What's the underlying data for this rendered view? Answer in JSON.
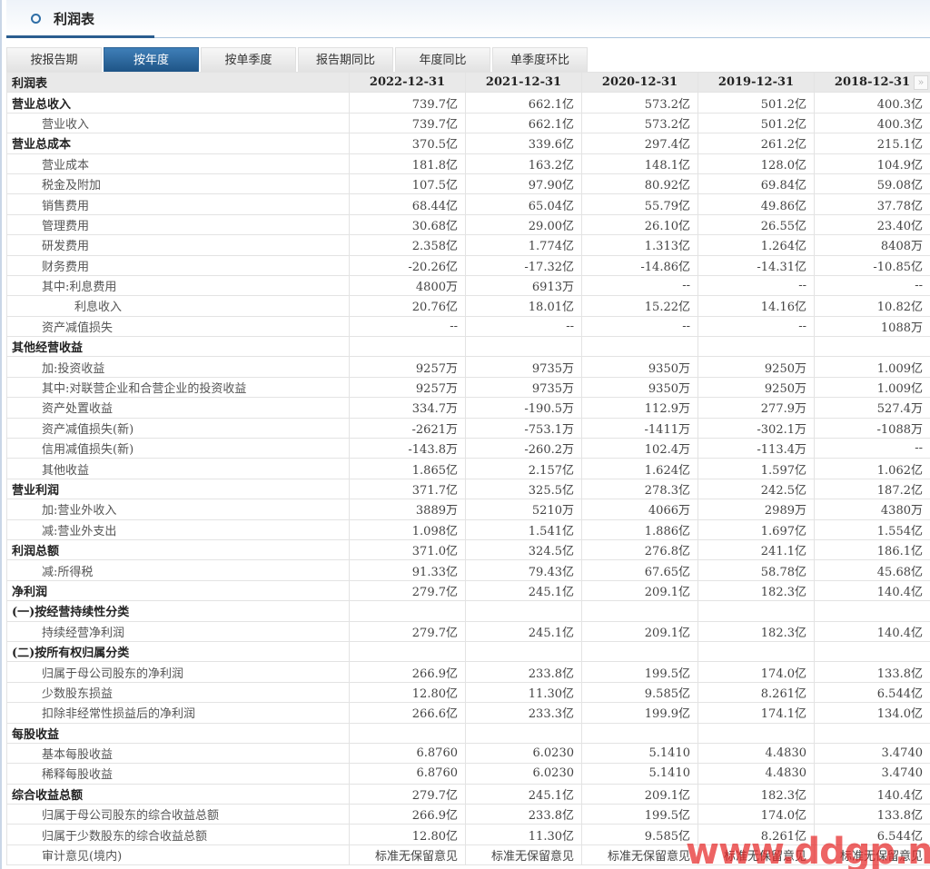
{
  "header": {
    "title": "利润表",
    "icon": "circle-icon"
  },
  "tabs": [
    {
      "label": "按报告期",
      "active": false
    },
    {
      "label": "按年度",
      "active": true
    },
    {
      "label": "按单季度",
      "active": false
    },
    {
      "label": "报告期同比",
      "active": false
    },
    {
      "label": "年度同比",
      "active": false
    },
    {
      "label": "单季度环比",
      "active": false
    }
  ],
  "table": {
    "corner_label": "利润表",
    "columns": [
      "2022-12-31",
      "2021-12-31",
      "2020-12-31",
      "2019-12-31",
      "2018-12-31"
    ],
    "next_button": "»",
    "rows": [
      {
        "label": "营业总收入",
        "level": 0,
        "values": [
          "739.7亿",
          "662.1亿",
          "573.2亿",
          "501.2亿",
          "400.3亿"
        ]
      },
      {
        "label": "营业收入",
        "level": 1,
        "values": [
          "739.7亿",
          "662.1亿",
          "573.2亿",
          "501.2亿",
          "400.3亿"
        ]
      },
      {
        "label": "营业总成本",
        "level": 0,
        "values": [
          "370.5亿",
          "339.6亿",
          "297.4亿",
          "261.2亿",
          "215.1亿"
        ]
      },
      {
        "label": "营业成本",
        "level": 1,
        "values": [
          "181.8亿",
          "163.2亿",
          "148.1亿",
          "128.0亿",
          "104.9亿"
        ]
      },
      {
        "label": "税金及附加",
        "level": 1,
        "values": [
          "107.5亿",
          "97.90亿",
          "80.92亿",
          "69.84亿",
          "59.08亿"
        ]
      },
      {
        "label": "销售费用",
        "level": 1,
        "values": [
          "68.44亿",
          "65.04亿",
          "55.79亿",
          "49.86亿",
          "37.78亿"
        ]
      },
      {
        "label": "管理费用",
        "level": 1,
        "values": [
          "30.68亿",
          "29.00亿",
          "26.10亿",
          "26.55亿",
          "23.40亿"
        ]
      },
      {
        "label": "研发费用",
        "level": 1,
        "values": [
          "2.358亿",
          "1.774亿",
          "1.313亿",
          "1.264亿",
          "8408万"
        ]
      },
      {
        "label": "财务费用",
        "level": 1,
        "values": [
          "-20.26亿",
          "-17.32亿",
          "-14.86亿",
          "-14.31亿",
          "-10.85亿"
        ]
      },
      {
        "label": "其中:利息费用",
        "level": 1,
        "values": [
          "4800万",
          "6913万",
          "--",
          "--",
          "--"
        ]
      },
      {
        "label": "利息收入",
        "level": 2,
        "values": [
          "20.76亿",
          "18.01亿",
          "15.22亿",
          "14.16亿",
          "10.82亿"
        ]
      },
      {
        "label": "资产减值损失",
        "level": 1,
        "values": [
          "--",
          "--",
          "--",
          "--",
          "1088万"
        ]
      },
      {
        "label": "其他经营收益",
        "level": 0,
        "values": [
          "",
          "",
          "",
          "",
          ""
        ]
      },
      {
        "label": "加:投资收益",
        "level": 1,
        "values": [
          "9257万",
          "9735万",
          "9350万",
          "9250万",
          "1.009亿"
        ]
      },
      {
        "label": "其中:对联营企业和合营企业的投资收益",
        "level": 1,
        "values": [
          "9257万",
          "9735万",
          "9350万",
          "9250万",
          "1.009亿"
        ]
      },
      {
        "label": "资产处置收益",
        "level": 1,
        "values": [
          "334.7万",
          "-190.5万",
          "112.9万",
          "277.9万",
          "527.4万"
        ]
      },
      {
        "label": "资产减值损失(新)",
        "level": 1,
        "values": [
          "-2621万",
          "-753.1万",
          "-1411万",
          "-302.1万",
          "-1088万"
        ]
      },
      {
        "label": "信用减值损失(新)",
        "level": 1,
        "values": [
          "-143.8万",
          "-260.2万",
          "102.4万",
          "-113.4万",
          "--"
        ]
      },
      {
        "label": "其他收益",
        "level": 1,
        "values": [
          "1.865亿",
          "2.157亿",
          "1.624亿",
          "1.597亿",
          "1.062亿"
        ]
      },
      {
        "label": "营业利润",
        "level": 0,
        "values": [
          "371.7亿",
          "325.5亿",
          "278.3亿",
          "242.5亿",
          "187.2亿"
        ]
      },
      {
        "label": "加:营业外收入",
        "level": 1,
        "values": [
          "3889万",
          "5210万",
          "4066万",
          "2989万",
          "4380万"
        ]
      },
      {
        "label": "减:营业外支出",
        "level": 1,
        "values": [
          "1.098亿",
          "1.541亿",
          "1.886亿",
          "1.697亿",
          "1.554亿"
        ]
      },
      {
        "label": "利润总额",
        "level": 0,
        "values": [
          "371.0亿",
          "324.5亿",
          "276.8亿",
          "241.1亿",
          "186.1亿"
        ]
      },
      {
        "label": "减:所得税",
        "level": 1,
        "values": [
          "91.33亿",
          "79.43亿",
          "67.65亿",
          "58.78亿",
          "45.68亿"
        ]
      },
      {
        "label": "净利润",
        "level": 0,
        "values": [
          "279.7亿",
          "245.1亿",
          "209.1亿",
          "182.3亿",
          "140.4亿"
        ]
      },
      {
        "label": "(一)按经营持续性分类",
        "level": 0,
        "values": [
          "",
          "",
          "",
          "",
          ""
        ]
      },
      {
        "label": "持续经营净利润",
        "level": 1,
        "values": [
          "279.7亿",
          "245.1亿",
          "209.1亿",
          "182.3亿",
          "140.4亿"
        ]
      },
      {
        "label": "(二)按所有权归属分类",
        "level": 0,
        "values": [
          "",
          "",
          "",
          "",
          ""
        ]
      },
      {
        "label": "归属于母公司股东的净利润",
        "level": 1,
        "values": [
          "266.9亿",
          "233.8亿",
          "199.5亿",
          "174.0亿",
          "133.8亿"
        ]
      },
      {
        "label": "少数股东损益",
        "level": 1,
        "values": [
          "12.80亿",
          "11.30亿",
          "9.585亿",
          "8.261亿",
          "6.544亿"
        ]
      },
      {
        "label": "扣除非经常性损益后的净利润",
        "level": 1,
        "values": [
          "266.6亿",
          "233.3亿",
          "199.9亿",
          "174.1亿",
          "134.0亿"
        ]
      },
      {
        "label": "每股收益",
        "level": 0,
        "values": [
          "",
          "",
          "",
          "",
          ""
        ]
      },
      {
        "label": "基本每股收益",
        "level": 1,
        "values": [
          "6.8760",
          "6.0230",
          "5.1410",
          "4.4830",
          "3.4740"
        ]
      },
      {
        "label": "稀释每股收益",
        "level": 1,
        "values": [
          "6.8760",
          "6.0230",
          "5.1410",
          "4.4830",
          "3.4740"
        ]
      },
      {
        "label": "综合收益总额",
        "level": 0,
        "values": [
          "279.7亿",
          "245.1亿",
          "209.1亿",
          "182.3亿",
          "140.4亿"
        ]
      },
      {
        "label": "归属于母公司股东的综合收益总额",
        "level": 1,
        "values": [
          "266.9亿",
          "233.8亿",
          "199.5亿",
          "174.0亿",
          "133.8亿"
        ]
      },
      {
        "label": "归属于少数股东的综合收益总额",
        "level": 1,
        "values": [
          "12.80亿",
          "11.30亿",
          "9.585亿",
          "8.261亿",
          "6.544亿"
        ]
      },
      {
        "label": "审计意见(境内)",
        "level": 1,
        "values": [
          "标准无保留意见",
          "标准无保留意见",
          "标准无保留意见",
          "标准无保留意见",
          "标准无保留意见"
        ]
      }
    ]
  },
  "watermark": "www.ddgp.net"
}
